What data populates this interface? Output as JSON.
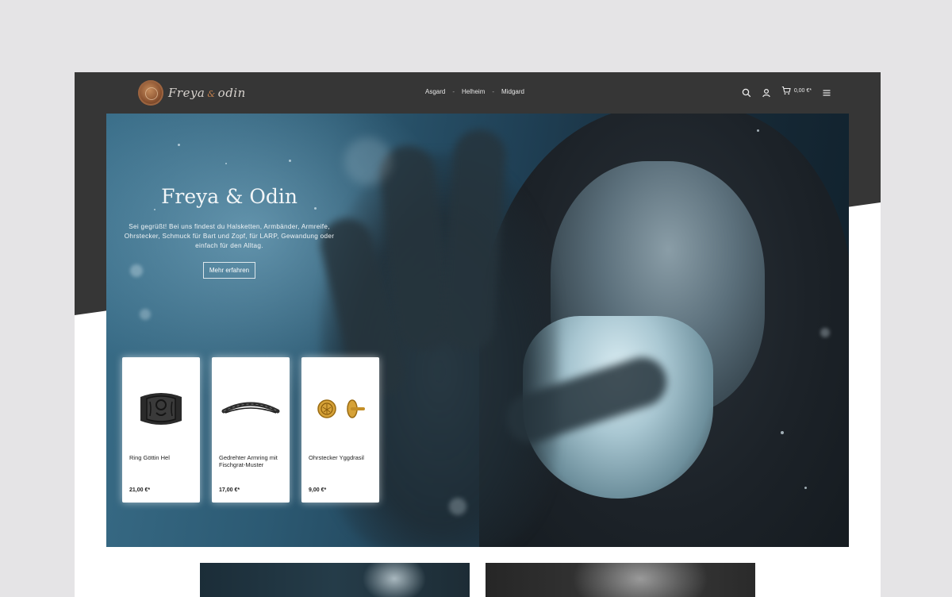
{
  "brand": {
    "name": "Freya",
    "amp": "&",
    "name2": "odin"
  },
  "nav": {
    "items": [
      "Asgard",
      "Helheim",
      "Midgard"
    ],
    "separator": "-"
  },
  "header": {
    "cart_total": "0,00 €*"
  },
  "hero": {
    "title": "Freya & Odin",
    "text": "Sei gegrüßt! Bei uns findest du Halsketten, Armbänder, Armreife, Ohrstecker, Schmuck für Bart und Zopf, für LARP, Gewandung oder einfach für den Alltag.",
    "cta": "Mehr erfahren"
  },
  "products": [
    {
      "name": "Ring Göttin Hel",
      "price": "21,00 €*"
    },
    {
      "name": "Gedrehter Armring mit Fischgrat-Muster",
      "price": "17,00 €*"
    },
    {
      "name": "Ohrstecker Yggdrasil",
      "price": "9,00 €*"
    }
  ],
  "colors": {
    "header_bg": "#363636",
    "accent": "#c7834f",
    "hero_blue": "#2c5a73"
  },
  "icons": [
    "search-icon",
    "user-icon",
    "cart-icon",
    "menu-icon"
  ]
}
